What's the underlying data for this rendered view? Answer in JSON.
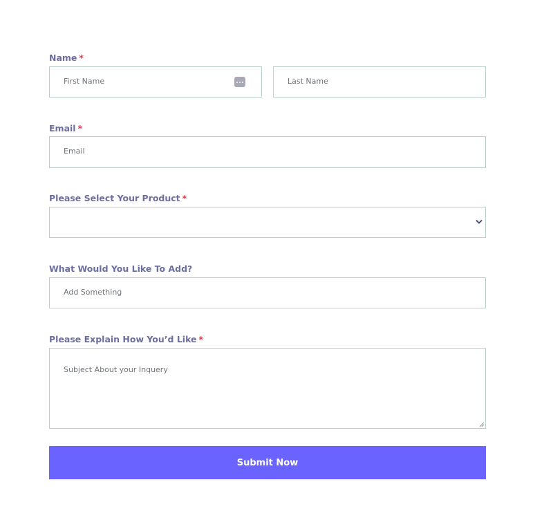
{
  "form": {
    "name": {
      "label": "Name",
      "required_mark": "*",
      "first_placeholder": "First Name",
      "last_placeholder": "Last Name"
    },
    "email": {
      "label": "Email",
      "required_mark": "*",
      "placeholder": "Email"
    },
    "product": {
      "label": "Please Select Your Product",
      "required_mark": "*",
      "selected": ""
    },
    "add": {
      "label": "What Would You Like To Add?",
      "placeholder": "Add Something"
    },
    "explain": {
      "label": "Please Explain How You’d Like",
      "required_mark": "*",
      "placeholder": "Subject About your Inquery"
    },
    "submit_label": "Submit Now"
  },
  "colors": {
    "label": "#6b6e9e",
    "required": "#e0394b",
    "border": "#b9d1c9",
    "button": "#6b63ff",
    "button_text": "#ffffff"
  },
  "icons": {
    "autofill": "dots-icon",
    "select": "chevron-down-icon",
    "resize": "resize-handle-icon"
  }
}
